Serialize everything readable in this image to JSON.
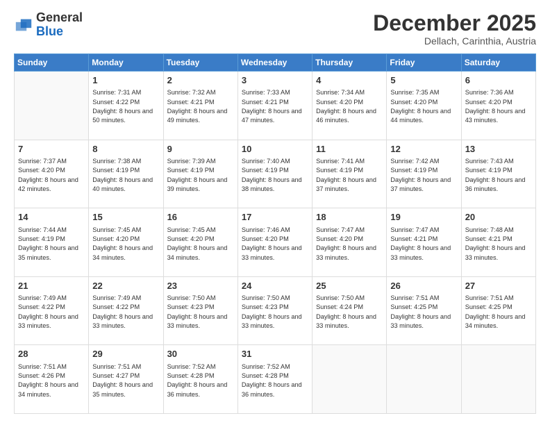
{
  "logo": {
    "general": "General",
    "blue": "Blue"
  },
  "header": {
    "month": "December 2025",
    "location": "Dellach, Carinthia, Austria"
  },
  "weekdays": [
    "Sunday",
    "Monday",
    "Tuesday",
    "Wednesday",
    "Thursday",
    "Friday",
    "Saturday"
  ],
  "weeks": [
    [
      {
        "day": "",
        "sunrise": "",
        "sunset": "",
        "daylight": ""
      },
      {
        "day": "1",
        "sunrise": "Sunrise: 7:31 AM",
        "sunset": "Sunset: 4:22 PM",
        "daylight": "Daylight: 8 hours and 50 minutes."
      },
      {
        "day": "2",
        "sunrise": "Sunrise: 7:32 AM",
        "sunset": "Sunset: 4:21 PM",
        "daylight": "Daylight: 8 hours and 49 minutes."
      },
      {
        "day": "3",
        "sunrise": "Sunrise: 7:33 AM",
        "sunset": "Sunset: 4:21 PM",
        "daylight": "Daylight: 8 hours and 47 minutes."
      },
      {
        "day": "4",
        "sunrise": "Sunrise: 7:34 AM",
        "sunset": "Sunset: 4:20 PM",
        "daylight": "Daylight: 8 hours and 46 minutes."
      },
      {
        "day": "5",
        "sunrise": "Sunrise: 7:35 AM",
        "sunset": "Sunset: 4:20 PM",
        "daylight": "Daylight: 8 hours and 44 minutes."
      },
      {
        "day": "6",
        "sunrise": "Sunrise: 7:36 AM",
        "sunset": "Sunset: 4:20 PM",
        "daylight": "Daylight: 8 hours and 43 minutes."
      }
    ],
    [
      {
        "day": "7",
        "sunrise": "Sunrise: 7:37 AM",
        "sunset": "Sunset: 4:20 PM",
        "daylight": "Daylight: 8 hours and 42 minutes."
      },
      {
        "day": "8",
        "sunrise": "Sunrise: 7:38 AM",
        "sunset": "Sunset: 4:19 PM",
        "daylight": "Daylight: 8 hours and 40 minutes."
      },
      {
        "day": "9",
        "sunrise": "Sunrise: 7:39 AM",
        "sunset": "Sunset: 4:19 PM",
        "daylight": "Daylight: 8 hours and 39 minutes."
      },
      {
        "day": "10",
        "sunrise": "Sunrise: 7:40 AM",
        "sunset": "Sunset: 4:19 PM",
        "daylight": "Daylight: 8 hours and 38 minutes."
      },
      {
        "day": "11",
        "sunrise": "Sunrise: 7:41 AM",
        "sunset": "Sunset: 4:19 PM",
        "daylight": "Daylight: 8 hours and 37 minutes."
      },
      {
        "day": "12",
        "sunrise": "Sunrise: 7:42 AM",
        "sunset": "Sunset: 4:19 PM",
        "daylight": "Daylight: 8 hours and 37 minutes."
      },
      {
        "day": "13",
        "sunrise": "Sunrise: 7:43 AM",
        "sunset": "Sunset: 4:19 PM",
        "daylight": "Daylight: 8 hours and 36 minutes."
      }
    ],
    [
      {
        "day": "14",
        "sunrise": "Sunrise: 7:44 AM",
        "sunset": "Sunset: 4:19 PM",
        "daylight": "Daylight: 8 hours and 35 minutes."
      },
      {
        "day": "15",
        "sunrise": "Sunrise: 7:45 AM",
        "sunset": "Sunset: 4:20 PM",
        "daylight": "Daylight: 8 hours and 34 minutes."
      },
      {
        "day": "16",
        "sunrise": "Sunrise: 7:45 AM",
        "sunset": "Sunset: 4:20 PM",
        "daylight": "Daylight: 8 hours and 34 minutes."
      },
      {
        "day": "17",
        "sunrise": "Sunrise: 7:46 AM",
        "sunset": "Sunset: 4:20 PM",
        "daylight": "Daylight: 8 hours and 33 minutes."
      },
      {
        "day": "18",
        "sunrise": "Sunrise: 7:47 AM",
        "sunset": "Sunset: 4:20 PM",
        "daylight": "Daylight: 8 hours and 33 minutes."
      },
      {
        "day": "19",
        "sunrise": "Sunrise: 7:47 AM",
        "sunset": "Sunset: 4:21 PM",
        "daylight": "Daylight: 8 hours and 33 minutes."
      },
      {
        "day": "20",
        "sunrise": "Sunrise: 7:48 AM",
        "sunset": "Sunset: 4:21 PM",
        "daylight": "Daylight: 8 hours and 33 minutes."
      }
    ],
    [
      {
        "day": "21",
        "sunrise": "Sunrise: 7:49 AM",
        "sunset": "Sunset: 4:22 PM",
        "daylight": "Daylight: 8 hours and 33 minutes."
      },
      {
        "day": "22",
        "sunrise": "Sunrise: 7:49 AM",
        "sunset": "Sunset: 4:22 PM",
        "daylight": "Daylight: 8 hours and 33 minutes."
      },
      {
        "day": "23",
        "sunrise": "Sunrise: 7:50 AM",
        "sunset": "Sunset: 4:23 PM",
        "daylight": "Daylight: 8 hours and 33 minutes."
      },
      {
        "day": "24",
        "sunrise": "Sunrise: 7:50 AM",
        "sunset": "Sunset: 4:23 PM",
        "daylight": "Daylight: 8 hours and 33 minutes."
      },
      {
        "day": "25",
        "sunrise": "Sunrise: 7:50 AM",
        "sunset": "Sunset: 4:24 PM",
        "daylight": "Daylight: 8 hours and 33 minutes."
      },
      {
        "day": "26",
        "sunrise": "Sunrise: 7:51 AM",
        "sunset": "Sunset: 4:25 PM",
        "daylight": "Daylight: 8 hours and 33 minutes."
      },
      {
        "day": "27",
        "sunrise": "Sunrise: 7:51 AM",
        "sunset": "Sunset: 4:25 PM",
        "daylight": "Daylight: 8 hours and 34 minutes."
      }
    ],
    [
      {
        "day": "28",
        "sunrise": "Sunrise: 7:51 AM",
        "sunset": "Sunset: 4:26 PM",
        "daylight": "Daylight: 8 hours and 34 minutes."
      },
      {
        "day": "29",
        "sunrise": "Sunrise: 7:51 AM",
        "sunset": "Sunset: 4:27 PM",
        "daylight": "Daylight: 8 hours and 35 minutes."
      },
      {
        "day": "30",
        "sunrise": "Sunrise: 7:52 AM",
        "sunset": "Sunset: 4:28 PM",
        "daylight": "Daylight: 8 hours and 36 minutes."
      },
      {
        "day": "31",
        "sunrise": "Sunrise: 7:52 AM",
        "sunset": "Sunset: 4:28 PM",
        "daylight": "Daylight: 8 hours and 36 minutes."
      },
      {
        "day": "",
        "sunrise": "",
        "sunset": "",
        "daylight": ""
      },
      {
        "day": "",
        "sunrise": "",
        "sunset": "",
        "daylight": ""
      },
      {
        "day": "",
        "sunrise": "",
        "sunset": "",
        "daylight": ""
      }
    ]
  ]
}
